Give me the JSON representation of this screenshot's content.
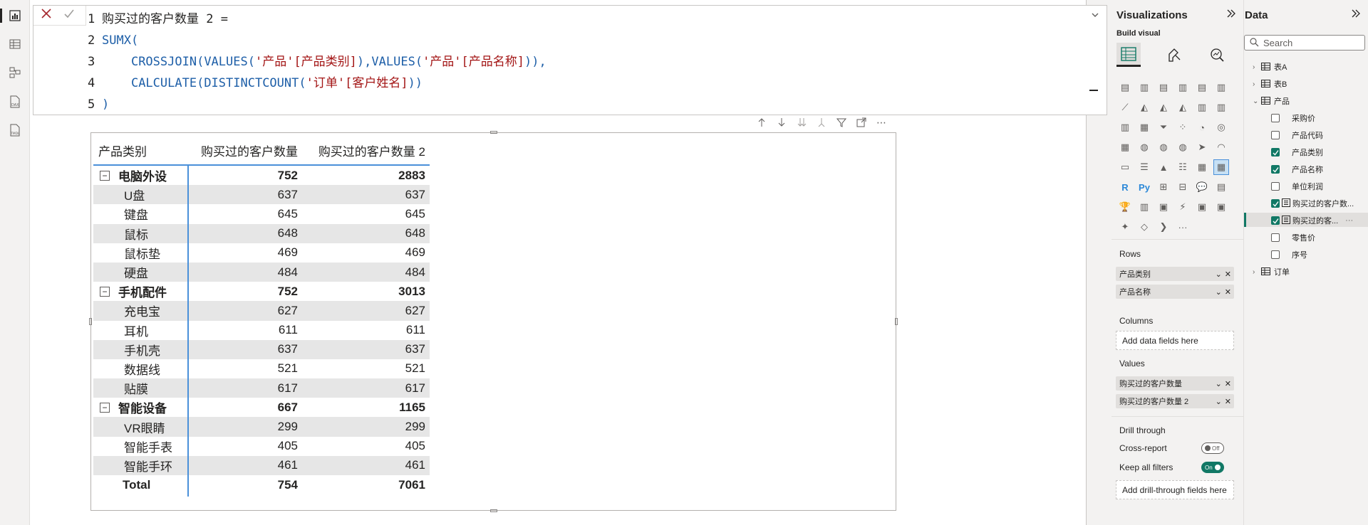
{
  "formula": {
    "cancel_icon": "close-icon",
    "commit_icon": "check-icon",
    "line_numbers": [
      "1",
      "2",
      "3",
      "4",
      "5"
    ],
    "line1_text": "购买过的客户数量 2 =",
    "line2_text": "SUMX(",
    "line3_crossjoin": "CROSSJOIN(",
    "line3_values1": "VALUES(",
    "line3_ref1": "'产品'[产品类别]",
    "line3_mid": "),",
    "line3_values2": "VALUES(",
    "line3_ref2": "'产品'[产品名称]",
    "line3_end": ")),",
    "line4_calc": "CALCULATE(",
    "line4_dc": "DISTINCTCOUNT(",
    "line4_ref": "'订单'[客户姓名]",
    "line4_end": "))",
    "line5_text": ")"
  },
  "matrix": {
    "headers": [
      "产品类别",
      "购买过的客户数量",
      "购买过的客户数量 2"
    ],
    "groups": [
      {
        "name": "电脑外设",
        "v1": "752",
        "v2": "2883",
        "items": [
          {
            "name": "U盘",
            "v1": "637",
            "v2": "637"
          },
          {
            "name": "键盘",
            "v1": "645",
            "v2": "645"
          },
          {
            "name": "鼠标",
            "v1": "648",
            "v2": "648"
          },
          {
            "name": "鼠标垫",
            "v1": "469",
            "v2": "469"
          },
          {
            "name": "硬盘",
            "v1": "484",
            "v2": "484"
          }
        ]
      },
      {
        "name": "手机配件",
        "v1": "752",
        "v2": "3013",
        "items": [
          {
            "name": "充电宝",
            "v1": "627",
            "v2": "627"
          },
          {
            "name": "耳机",
            "v1": "611",
            "v2": "611"
          },
          {
            "name": "手机壳",
            "v1": "637",
            "v2": "637"
          },
          {
            "name": "数据线",
            "v1": "521",
            "v2": "521"
          },
          {
            "name": "贴膜",
            "v1": "617",
            "v2": "617"
          }
        ]
      },
      {
        "name": "智能设备",
        "v1": "667",
        "v2": "1165",
        "items": [
          {
            "name": "VR眼睛",
            "v1": "299",
            "v2": "299"
          },
          {
            "name": "智能手表",
            "v1": "405",
            "v2": "405"
          },
          {
            "name": "智能手环",
            "v1": "461",
            "v2": "461"
          }
        ]
      }
    ],
    "total": {
      "name": "Total",
      "v1": "754",
      "v2": "7061"
    },
    "collapse_glyph": "−"
  },
  "visualizations": {
    "title": "Visualizations",
    "build_visual": "Build visual",
    "rows_label": "Rows",
    "rows_fields": [
      "产品类别",
      "产品名称"
    ],
    "columns_label": "Columns",
    "columns_add": "Add data fields here",
    "values_label": "Values",
    "values_fields": [
      "购买过的客户数量",
      "购买过的客户数量 2"
    ],
    "drill_label": "Drill through",
    "cross_report_label": "Cross-report",
    "cross_report_state": "Off",
    "keep_filters_label": "Keep all filters",
    "keep_filters_state": "On",
    "drill_add": "Add drill-through fields here",
    "more_glyph": "···"
  },
  "data_pane": {
    "title": "Data",
    "search_placeholder": "Search",
    "tables": [
      "表A",
      "表B",
      "产品",
      "订单"
    ],
    "product_fields": [
      {
        "name": "采购价",
        "checked": false
      },
      {
        "name": "产品代码",
        "checked": false
      },
      {
        "name": "产品类别",
        "checked": true
      },
      {
        "name": "产品名称",
        "checked": true
      },
      {
        "name": "单位利润",
        "checked": false
      },
      {
        "name": "购买过的客户数...",
        "checked": true
      },
      {
        "name": "购买过的客...",
        "checked": true
      },
      {
        "name": "零售价",
        "checked": false
      },
      {
        "name": "序号",
        "checked": false
      }
    ],
    "more_glyph": "···"
  },
  "colors": {
    "accent_teal": "#117865",
    "matrix_blue": "#4a90d9",
    "keyword_blue": "#1e5fa8",
    "string_red": "#a31515"
  }
}
